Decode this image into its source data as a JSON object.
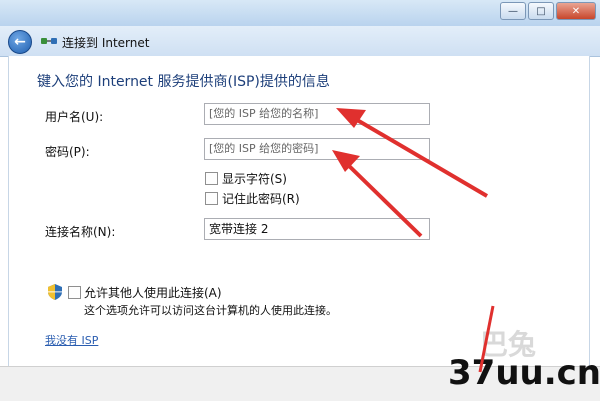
{
  "window": {
    "title": "连接到 Internet",
    "controls": {
      "minimize": "—",
      "maximize": "□",
      "close": "✕"
    }
  },
  "icons": {
    "back": "back-arrow-icon",
    "network": "network-icon",
    "shield": "uac-shield-icon"
  },
  "form": {
    "heading": "键入您的 Internet 服务提供商(ISP)提供的信息",
    "username": {
      "label": "用户名(U):",
      "placeholder": "[您的 ISP 给您的名称]"
    },
    "password": {
      "label": "密码(P):",
      "placeholder": "[您的 ISP 给您的密码]"
    },
    "show_chars": {
      "label": "显示字符(S)",
      "checked": false
    },
    "remember_password": {
      "label": "记住此密码(R)",
      "checked": false
    },
    "connection_name": {
      "label": "连接名称(N):",
      "value": "宽带连接 2"
    },
    "allow_others": {
      "label": "允许其他人使用此连接(A)",
      "checked": false
    },
    "allow_others_desc": "这个选项允许可以访问这台计算机的人使用此连接。",
    "no_isp_link": "我没有 ISP"
  },
  "watermark": {
    "text": "37uu.cn",
    "faint": "巴兔"
  },
  "colors": {
    "accent": "#1d3f7a",
    "link": "#2a5db0",
    "annotation": "#e0302e"
  }
}
